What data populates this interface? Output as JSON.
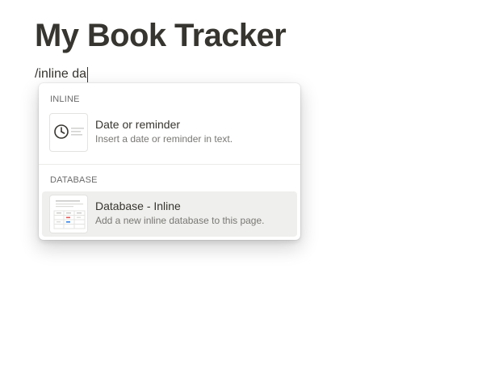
{
  "page": {
    "title": "My Book Tracker",
    "command_text": "/inline da"
  },
  "menu": {
    "sections": [
      {
        "label": "INLINE",
        "items": [
          {
            "title": "Date or reminder",
            "description": "Insert a date or reminder in text.",
            "icon": "clock-icon"
          }
        ]
      },
      {
        "label": "DATABASE",
        "items": [
          {
            "title": "Database - Inline",
            "description": "Add a new inline database to this page.",
            "icon": "table-icon",
            "highlighted": true
          }
        ]
      }
    ]
  },
  "colors": {
    "text": "#37352f",
    "muted": "#787774",
    "highlight": "#efefed",
    "red_accent": "#eb5757",
    "blue_accent": "#2f80ed"
  }
}
